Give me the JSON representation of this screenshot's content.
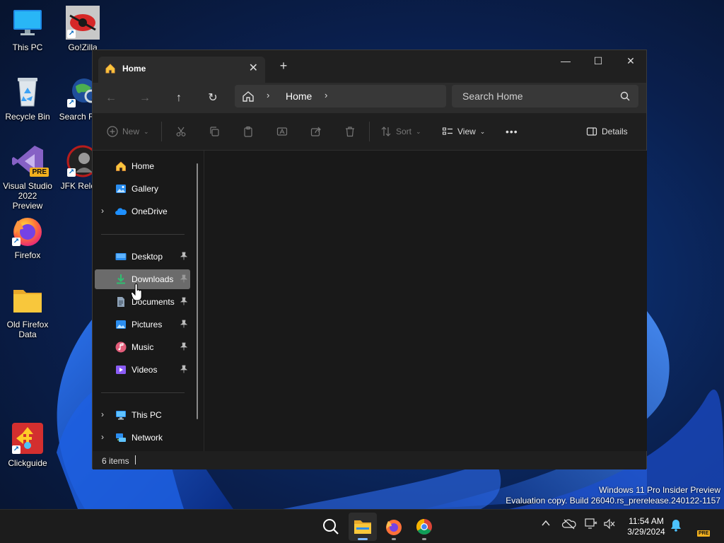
{
  "desktop": {
    "icons": [
      {
        "label": "This PC"
      },
      {
        "label": "Go!Zilla"
      },
      {
        "label": "Recycle Bin"
      },
      {
        "label": "Search Files"
      },
      {
        "label": "Visual Studio 2022 Preview",
        "badge": "PRE"
      },
      {
        "label": "JFK Reload"
      },
      {
        "label": "Firefox"
      },
      {
        "label": "Old Firefox Data"
      },
      {
        "label": "Clickguide"
      }
    ]
  },
  "explorer": {
    "tab_title": "Home",
    "new_tab_label": "+",
    "controls": {
      "minimize": "—",
      "maximize": "☐",
      "close": "✕"
    },
    "nav": {
      "back": "←",
      "forward": "→",
      "up": "↑",
      "refresh": "↻"
    },
    "address": {
      "crumb": "Home"
    },
    "search": {
      "placeholder": "Search Home"
    },
    "commands": {
      "new": "New",
      "sort": "Sort",
      "view": "View",
      "more": "•••",
      "details": "Details"
    },
    "sidebar": {
      "items": [
        {
          "label": "Home"
        },
        {
          "label": "Gallery"
        },
        {
          "label": "OneDrive"
        },
        {
          "label": "Desktop"
        },
        {
          "label": "Downloads"
        },
        {
          "label": "Documents"
        },
        {
          "label": "Pictures"
        },
        {
          "label": "Music"
        },
        {
          "label": "Videos"
        },
        {
          "label": "This PC"
        },
        {
          "label": "Network"
        }
      ]
    },
    "status": {
      "item_count": "6 items"
    }
  },
  "watermark": {
    "line1": "Windows 11 Pro Insider Preview",
    "line2": "Evaluation copy. Build 26040.rs_prerelease.240122-1157"
  },
  "taskbar": {
    "clock": {
      "time": "11:54 AM",
      "date": "3/29/2024"
    },
    "tray_badge": "PRE"
  },
  "colors": {
    "accent": "#4cc2ff",
    "folder": "#f8c73c",
    "window_bg": "#191919",
    "selected": "#6b6b6b"
  }
}
